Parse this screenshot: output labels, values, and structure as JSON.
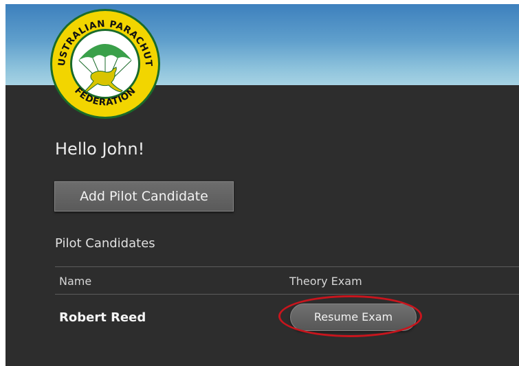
{
  "brand": {
    "logo_top_text": "AUSTRALIAN PARACHUTE",
    "logo_bottom_text": "FEDERATION",
    "ring_color": "#f2d500",
    "ring_border_color": "#1a6b2a",
    "inner_color": "#ffffff",
    "canopy_color": "#3aa04a",
    "kangaroo_color": "#d9c400"
  },
  "greeting": "Hello John!",
  "actions": {
    "add_candidate_label": "Add Pilot Candidate"
  },
  "candidates": {
    "title": "Pilot Candidates",
    "columns": [
      "Name",
      "Theory Exam"
    ],
    "rows": [
      {
        "name": "Robert Reed",
        "exam_action": "Resume Exam"
      }
    ]
  },
  "annotation": {
    "highlight_color": "#c8151d"
  }
}
